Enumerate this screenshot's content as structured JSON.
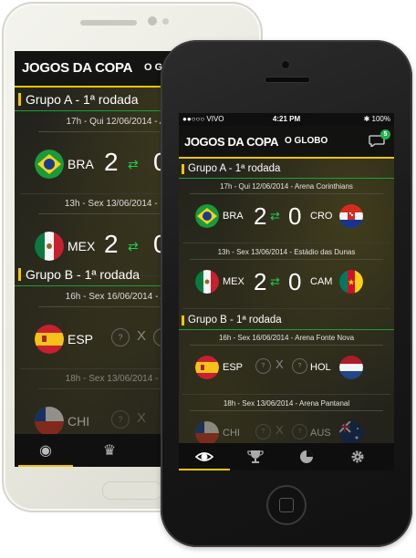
{
  "app": {
    "title": "JOGOS DA COPA",
    "brand": "O GLOBO",
    "chat_badge": "5"
  },
  "status_bar": {
    "carrier": "●●○○○ VIVO",
    "time": "4:21 PM",
    "battery": "✱ 100%"
  },
  "groups": [
    {
      "label": "Grupo A - 1ª rodada"
    },
    {
      "label": "Grupo B - 1ª rodada"
    }
  ],
  "matches": [
    {
      "meta": "17h - Qui 12/06/2014 - Arena Corinthians",
      "home": "BRA",
      "away": "CRO",
      "home_score": "2",
      "away_score": "0"
    },
    {
      "meta": "13h - Sex 13/06/2014 - Estádio das Dunas",
      "home": "MEX",
      "away": "CAM",
      "home_score": "2",
      "away_score": "0"
    },
    {
      "meta": "16h - Sex 16/06/2014 - Arena Fonte Nova",
      "home": "ESP",
      "away": "HOL",
      "q": "?",
      "vs": "X"
    },
    {
      "meta": "18h - Sex 13/06/2014 - Arena Pantanal",
      "home": "CHI",
      "away": "AUS",
      "q": "?",
      "vs": "X"
    }
  ],
  "back_device": {
    "title": "JOGOS DA COPA",
    "brand": "O GLO",
    "groups": [
      "Grupo A - 1ª rodada",
      "Grupo B - 1ª rodada"
    ],
    "matches": [
      {
        "meta": "17h - Qui 12/06/2014 - Arena",
        "code": "BRA",
        "score": "2",
        "score2": "0"
      },
      {
        "meta": "13h - Sex 13/06/2014 - Estádi",
        "code": "MEX",
        "score": "2",
        "score2": "0"
      },
      {
        "meta": "16h - Sex 16/06/2014 - Arena",
        "code": "ESP",
        "q": "?",
        "vs": "X"
      },
      {
        "meta": "18h - Sex 13/06/2014 - Arena",
        "code": "CHI",
        "q": "?",
        "vs": "X"
      }
    ]
  },
  "tabs": [
    {
      "name": "games",
      "icon": "ball-eye-icon",
      "active": true
    },
    {
      "name": "trophy",
      "icon": "trophy-icon"
    },
    {
      "name": "stats",
      "icon": "pie-chart-icon"
    },
    {
      "name": "settings",
      "icon": "gear-icon"
    }
  ],
  "colors": {
    "accent_yellow": "#f2c500",
    "accent_green": "#1d9f3a",
    "handshake_green": "#1fcf52"
  }
}
